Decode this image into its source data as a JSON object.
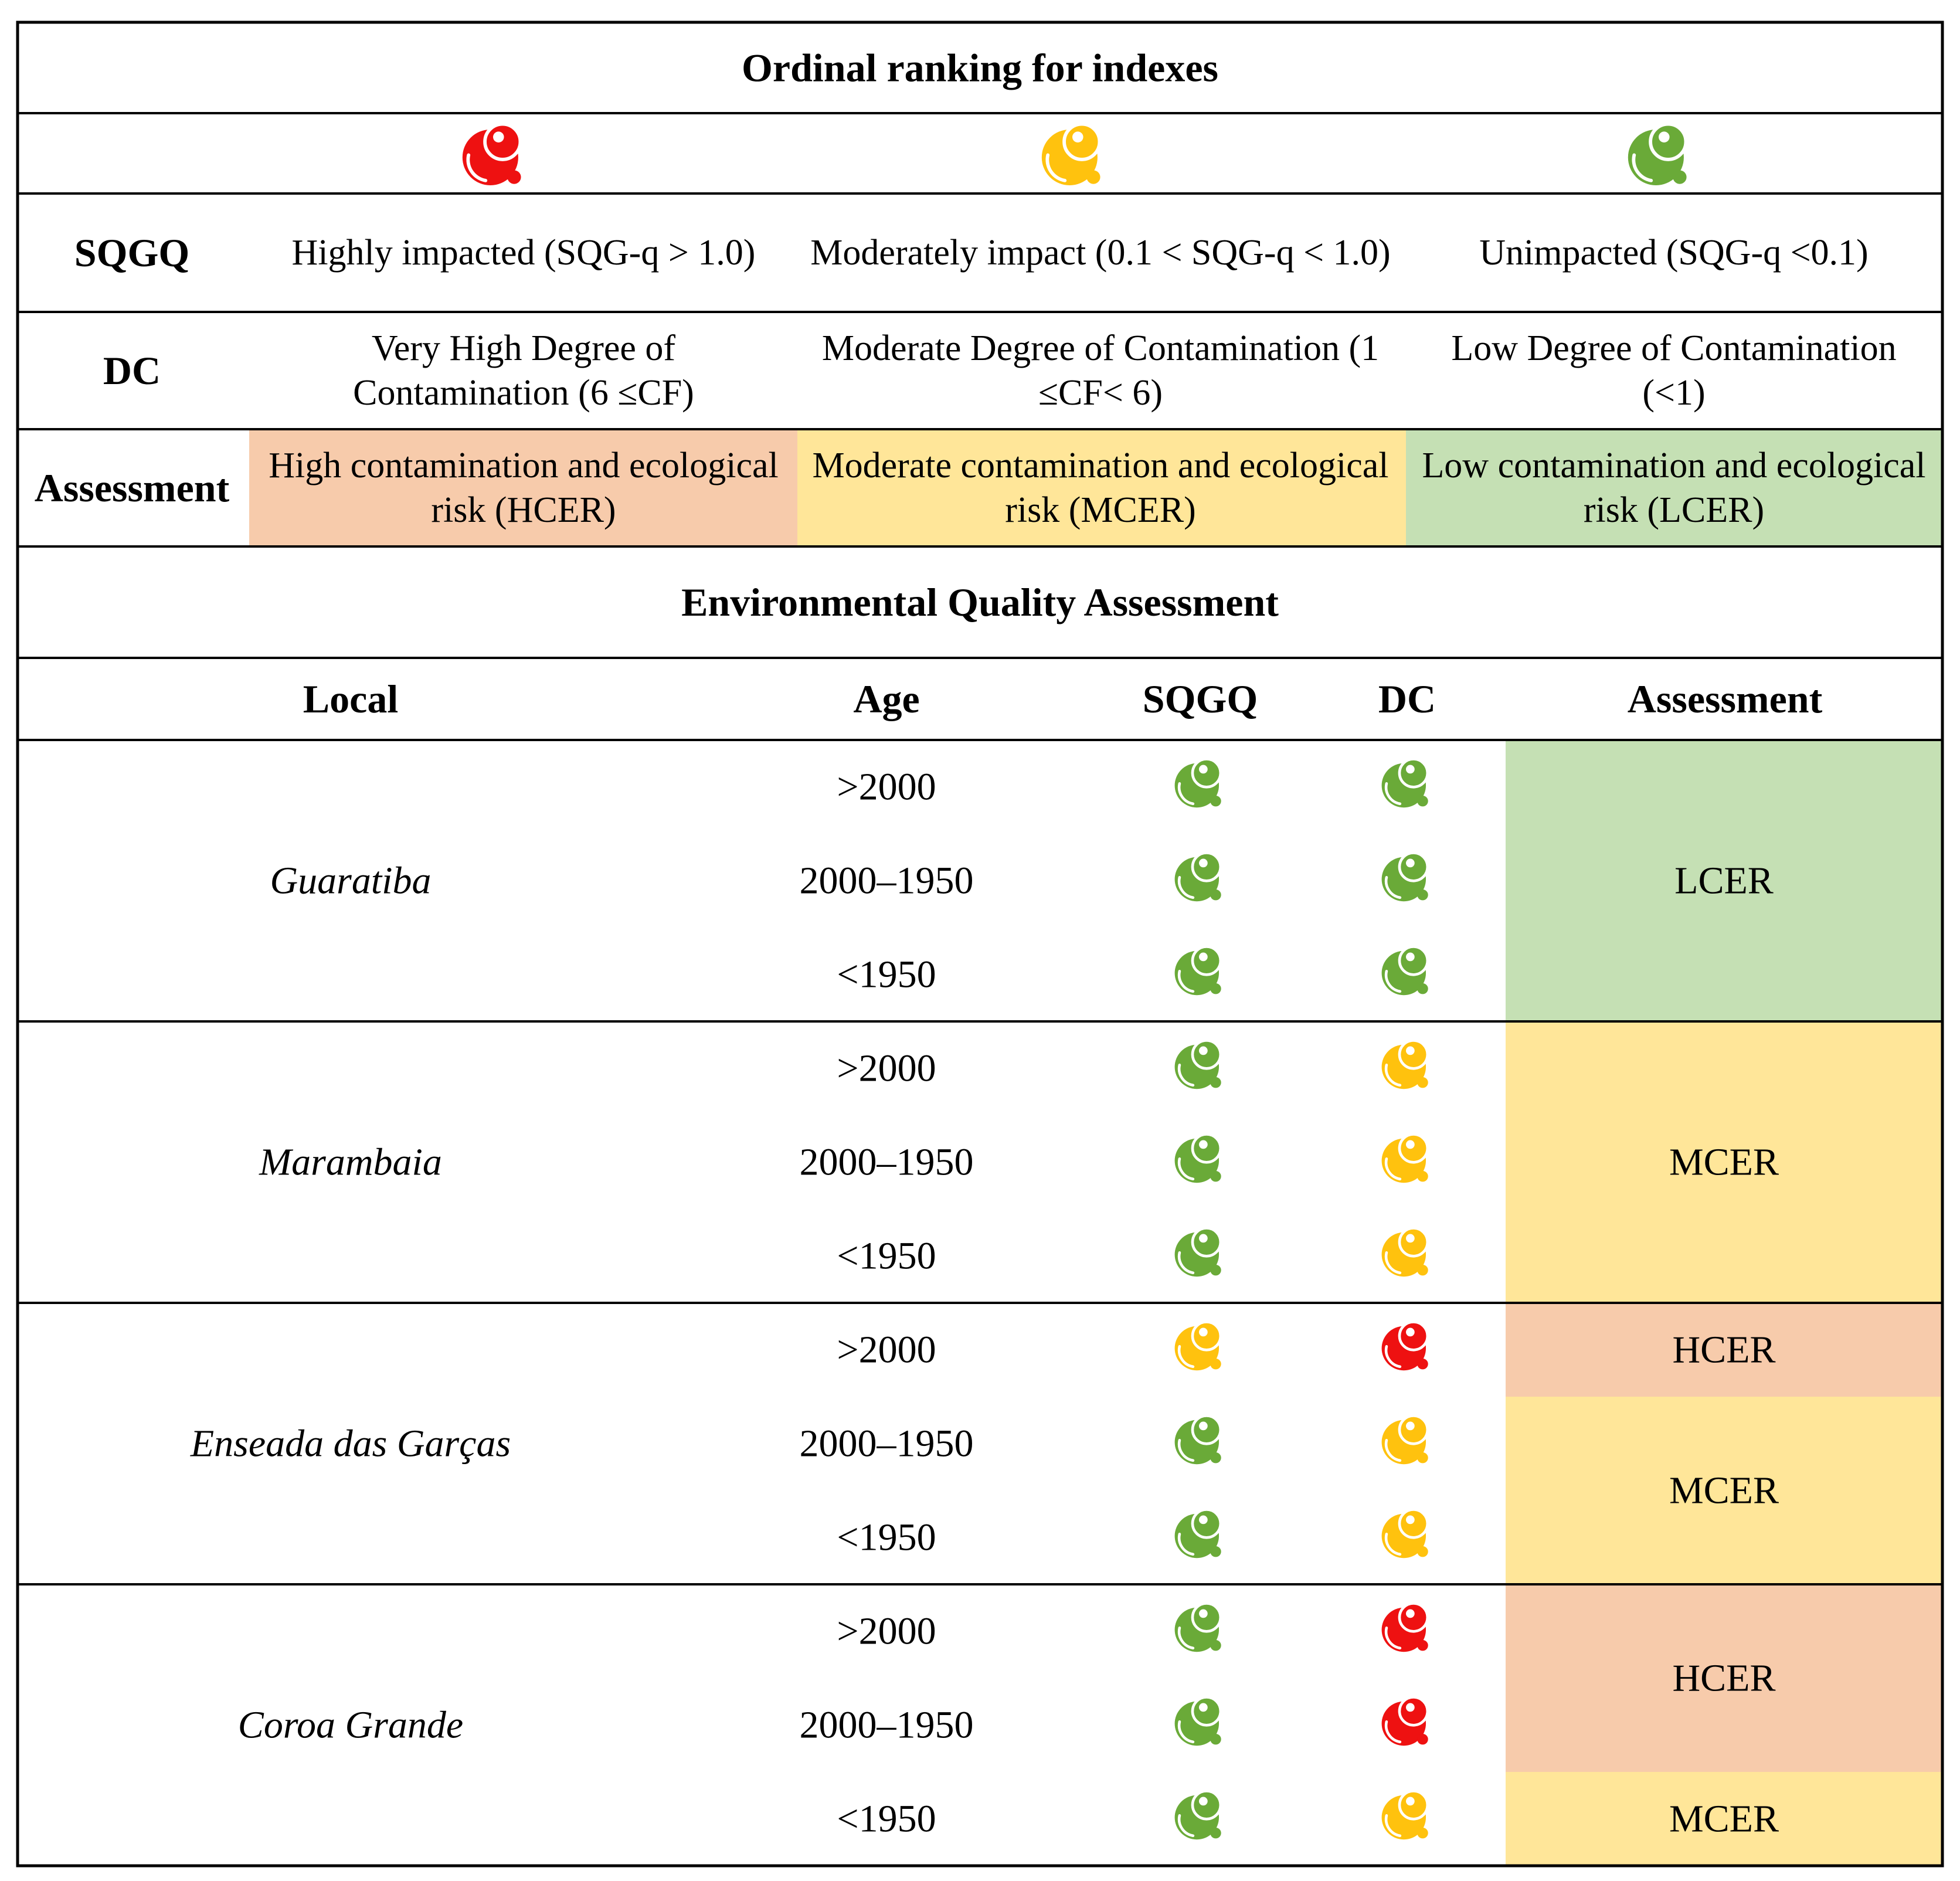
{
  "colors": {
    "red": "#ee1111",
    "yellow": "#ffc20e",
    "green": "#6aaa38",
    "high_bg": "#f7cbab",
    "moderate_bg": "#ffe699",
    "low_bg": "#c5e0b4"
  },
  "ranking": {
    "title": "Ordinal ranking for indexes",
    "levels": [
      "red",
      "yellow",
      "green"
    ],
    "rows": [
      {
        "label": "SQGQ",
        "cells": [
          [
            "Highly impacted (SQG-q > 1.0)"
          ],
          [
            "Moderately impact (0.1 < SQG-q < 1.0)"
          ],
          [
            "Unimpacted (SQG-q <0.1)"
          ]
        ]
      },
      {
        "label": "DC",
        "cells": [
          [
            "Very High Degree of",
            "Contamination (6 ≤CF)"
          ],
          [
            "Moderate Degree of Contamination (1",
            "≤CF< 6)"
          ],
          [
            "Low Degree of Contamination",
            "(<1)"
          ]
        ]
      },
      {
        "label": "Assessment",
        "cells": [
          [
            "High contamination and ecological",
            "risk (HCER)"
          ],
          [
            "Moderate contamination and ecological",
            "risk (MCER)"
          ],
          [
            "Low contamination and ecological",
            "risk (LCER)"
          ]
        ]
      }
    ]
  },
  "eqa": {
    "title": "Environmental Quality Assessment",
    "columns": [
      "Local",
      "Age",
      "SQGQ",
      "DC",
      "Assessment"
    ],
    "sites": [
      {
        "name": "Guaratiba",
        "rows": [
          {
            "age": ">2000",
            "sqgq": "green",
            "dc": "green"
          },
          {
            "age": "2000–1950",
            "sqgq": "green",
            "dc": "green"
          },
          {
            "age": "<1950",
            "sqgq": "green",
            "dc": "green"
          }
        ],
        "assessment": [
          {
            "label": "LCER",
            "level": "low",
            "span": 3
          }
        ]
      },
      {
        "name": "Marambaia",
        "rows": [
          {
            "age": ">2000",
            "sqgq": "green",
            "dc": "yellow"
          },
          {
            "age": "2000–1950",
            "sqgq": "green",
            "dc": "yellow"
          },
          {
            "age": "<1950",
            "sqgq": "green",
            "dc": "yellow"
          }
        ],
        "assessment": [
          {
            "label": "MCER",
            "level": "moderate",
            "span": 3
          }
        ]
      },
      {
        "name": "Enseada das Garças",
        "rows": [
          {
            "age": ">2000",
            "sqgq": "yellow",
            "dc": "red"
          },
          {
            "age": "2000–1950",
            "sqgq": "green",
            "dc": "yellow"
          },
          {
            "age": "<1950",
            "sqgq": "green",
            "dc": "yellow"
          }
        ],
        "assessment": [
          {
            "label": "HCER",
            "level": "high",
            "span": 1
          },
          {
            "label": "MCER",
            "level": "moderate",
            "span": 2
          }
        ]
      },
      {
        "name": "Coroa Grande",
        "rows": [
          {
            "age": ">2000",
            "sqgq": "green",
            "dc": "red"
          },
          {
            "age": "2000–1950",
            "sqgq": "green",
            "dc": "red"
          },
          {
            "age": "<1950",
            "sqgq": "green",
            "dc": "yellow"
          }
        ],
        "assessment": [
          {
            "label": "HCER",
            "level": "high",
            "span": 2
          },
          {
            "label": "MCER",
            "level": "moderate",
            "span": 1
          }
        ]
      }
    ]
  }
}
